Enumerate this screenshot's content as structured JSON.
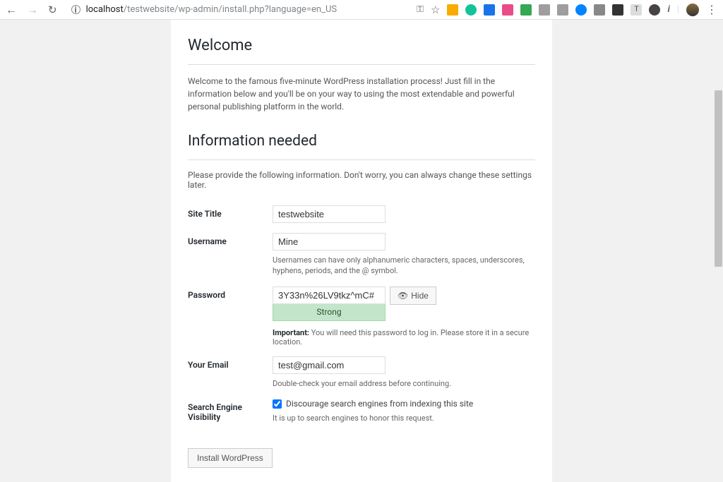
{
  "browser": {
    "url_host": "localhost",
    "url_path": "/testwebsite/wp-admin/install.php?language=en_US"
  },
  "page": {
    "heading_welcome": "Welcome",
    "intro": "Welcome to the famous five-minute WordPress installation process! Just fill in the information below and you'll be on your way to using the most extendable and powerful personal publishing platform in the world.",
    "heading_info": "Information needed",
    "info_sub": "Please provide the following information. Don't worry, you can always change these settings later.",
    "labels": {
      "site_title": "Site Title",
      "username": "Username",
      "password": "Password",
      "email": "Your Email",
      "search_visibility": "Search Engine Visibility"
    },
    "values": {
      "site_title": "testwebsite",
      "username": "Mine",
      "password": "3Y33n%26LV9tkz^mC#",
      "email": "test@gmail.com"
    },
    "hints": {
      "username": "Usernames can have only alphanumeric characters, spaces, underscores, hyphens, periods, and the @ symbol.",
      "password_strength": "Strong",
      "password_important_label": "Important:",
      "password_important_text": " You will need this password to log in. Please store it in a secure location.",
      "email": "Double-check your email address before continuing.",
      "search_checkbox": "Discourage search engines from indexing this site",
      "search_note": "It is up to search engines to honor this request."
    },
    "buttons": {
      "hide": "Hide",
      "install": "Install WordPress"
    }
  }
}
